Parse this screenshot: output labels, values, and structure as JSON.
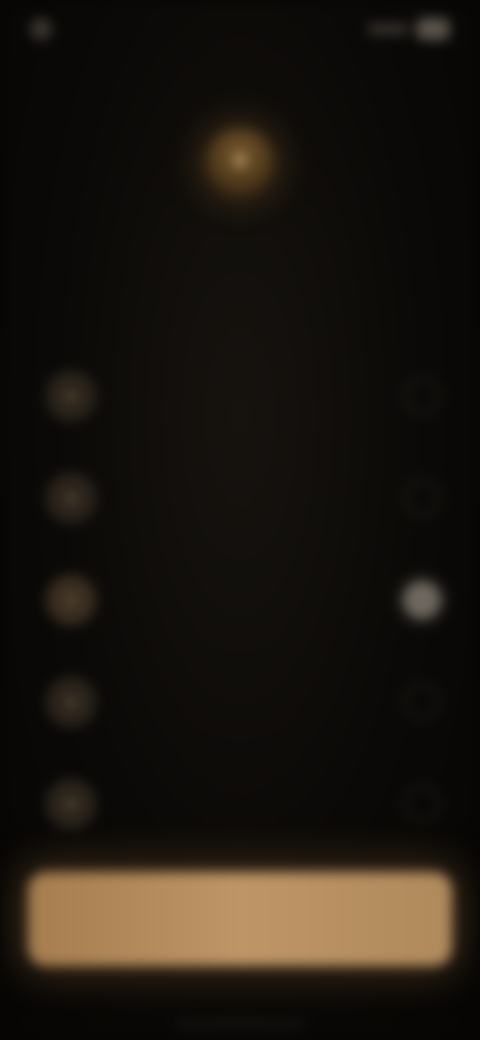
{
  "status_bar": {
    "time": "",
    "left_icon": "app-dot-icon",
    "right_icons": [
      "signal-icon",
      "battery-icon"
    ]
  },
  "header": {
    "breadcrumb": ""
  },
  "hero": {
    "icon": "star-icon",
    "glyph": "✦",
    "accent_color": "#7a5c30"
  },
  "title": {
    "headline": "",
    "subtitle": "",
    "subtitle_emphasis": ""
  },
  "options": [
    {
      "icon": "option-icon",
      "glyph": "●",
      "label": "",
      "selected": false
    },
    {
      "icon": "option-icon",
      "glyph": "●",
      "label": "",
      "selected": false
    },
    {
      "icon": "option-icon",
      "glyph": "●",
      "label": "",
      "selected": true
    },
    {
      "icon": "option-icon",
      "glyph": "●",
      "label": "",
      "selected": false
    },
    {
      "icon": "option-icon",
      "glyph": "●",
      "label": "",
      "selected": false
    }
  ],
  "cta": {
    "label": "",
    "color": "#be9566"
  },
  "colors": {
    "background": "#070605",
    "accent": "#be9566",
    "text_primary": "#c9c1b5",
    "text_secondary": "#8c847a"
  }
}
